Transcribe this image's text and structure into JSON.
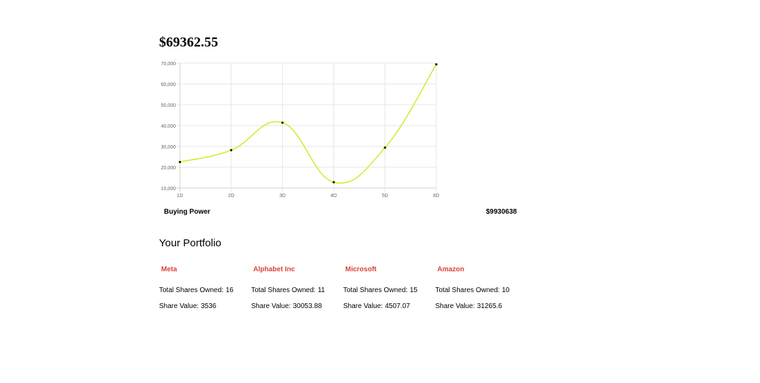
{
  "balance": "$69362.55",
  "buying_power": {
    "label": "Buying Power",
    "value": "$9930638"
  },
  "portfolio": {
    "title": "Your Portfolio",
    "shares_label": "Total Shares Owned:",
    "value_label": "Share Value:",
    "stocks": [
      {
        "name": "Meta",
        "shares": "16",
        "value": "3536"
      },
      {
        "name": "Alphabet Inc",
        "shares": "11",
        "value": "30053.88"
      },
      {
        "name": "Microsoft",
        "shares": "15",
        "value": "4507.07"
      },
      {
        "name": "Amazon",
        "shares": "10",
        "value": "31265.6"
      }
    ]
  },
  "colors": {
    "line": "#c6ef2a",
    "point": "#000000",
    "grid": "#e5e5e5",
    "stock_name": "#d9433b"
  },
  "chart_data": {
    "type": "line",
    "categories": [
      "1D",
      "2D",
      "3D",
      "4D",
      "5D",
      "6D"
    ],
    "values": [
      22500,
      28200,
      41400,
      12800,
      29400,
      69400
    ],
    "yticks": [
      "10,000",
      "20,000",
      "30,000",
      "40,000",
      "50,000",
      "60,000",
      "70,000"
    ],
    "ylim": [
      10000,
      70000
    ],
    "grid": true,
    "legend": "none",
    "smooth": true
  }
}
